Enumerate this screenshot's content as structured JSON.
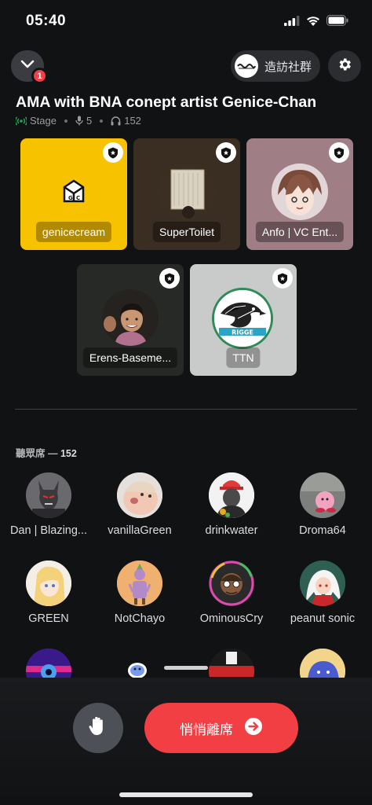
{
  "status_bar": {
    "time": "05:40",
    "icons": [
      "cellular-signal-icon",
      "wifi-icon",
      "battery-icon"
    ]
  },
  "top_bar": {
    "notification_badge": "1",
    "visit_label": "造訪社群"
  },
  "stage": {
    "title": "AMA with BNA conept artist Genice-Chan",
    "type_label": "Stage",
    "speakers_count": "5",
    "listeners_count": "152"
  },
  "speakers": [
    {
      "name": "genicecream",
      "tile_color": "#f7c200"
    },
    {
      "name": "SuperToilet",
      "tile_color": "#3a2d22"
    },
    {
      "name": "Anfo | VC Ent...",
      "tile_color": "#a07e86"
    },
    {
      "name": "Erens-Baseme...",
      "tile_color": "#262925"
    },
    {
      "name": "TTN",
      "tile_color": "#c9cbca"
    }
  ],
  "audience": {
    "label": "聽眾席",
    "count": "152",
    "members": [
      {
        "name": "Dan | Blazing..."
      },
      {
        "name": "vanillaGreen"
      },
      {
        "name": "drinkwater"
      },
      {
        "name": "Droma64"
      },
      {
        "name": "GREEN"
      },
      {
        "name": "NotChayo"
      },
      {
        "name": "OminousCry"
      },
      {
        "name": "peanut sonic"
      },
      {
        "name": ""
      },
      {
        "name": ""
      },
      {
        "name": ""
      },
      {
        "name": ""
      }
    ]
  },
  "actions": {
    "leave_label": "悄悄離席"
  },
  "colors": {
    "background": "#111214",
    "accent_red": "#f23f43",
    "stage_green": "#23a55a"
  }
}
